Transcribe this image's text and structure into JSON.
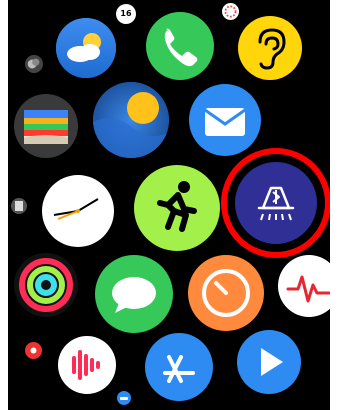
{
  "screen": {
    "apps": [
      {
        "id": "calendar",
        "label": "16"
      },
      {
        "id": "weather"
      },
      {
        "id": "phone"
      },
      {
        "id": "hearing"
      },
      {
        "id": "wallet"
      },
      {
        "id": "astronomy"
      },
      {
        "id": "mail"
      },
      {
        "id": "clock"
      },
      {
        "id": "workout"
      },
      {
        "id": "bluetooth-headlight"
      },
      {
        "id": "activity"
      },
      {
        "id": "messages"
      },
      {
        "id": "timer"
      },
      {
        "id": "ecg"
      },
      {
        "id": "noise"
      },
      {
        "id": "app-store"
      },
      {
        "id": "tv-remote"
      }
    ],
    "highlighted_app": "bluetooth-headlight",
    "highlight_color": "#ff0000"
  }
}
